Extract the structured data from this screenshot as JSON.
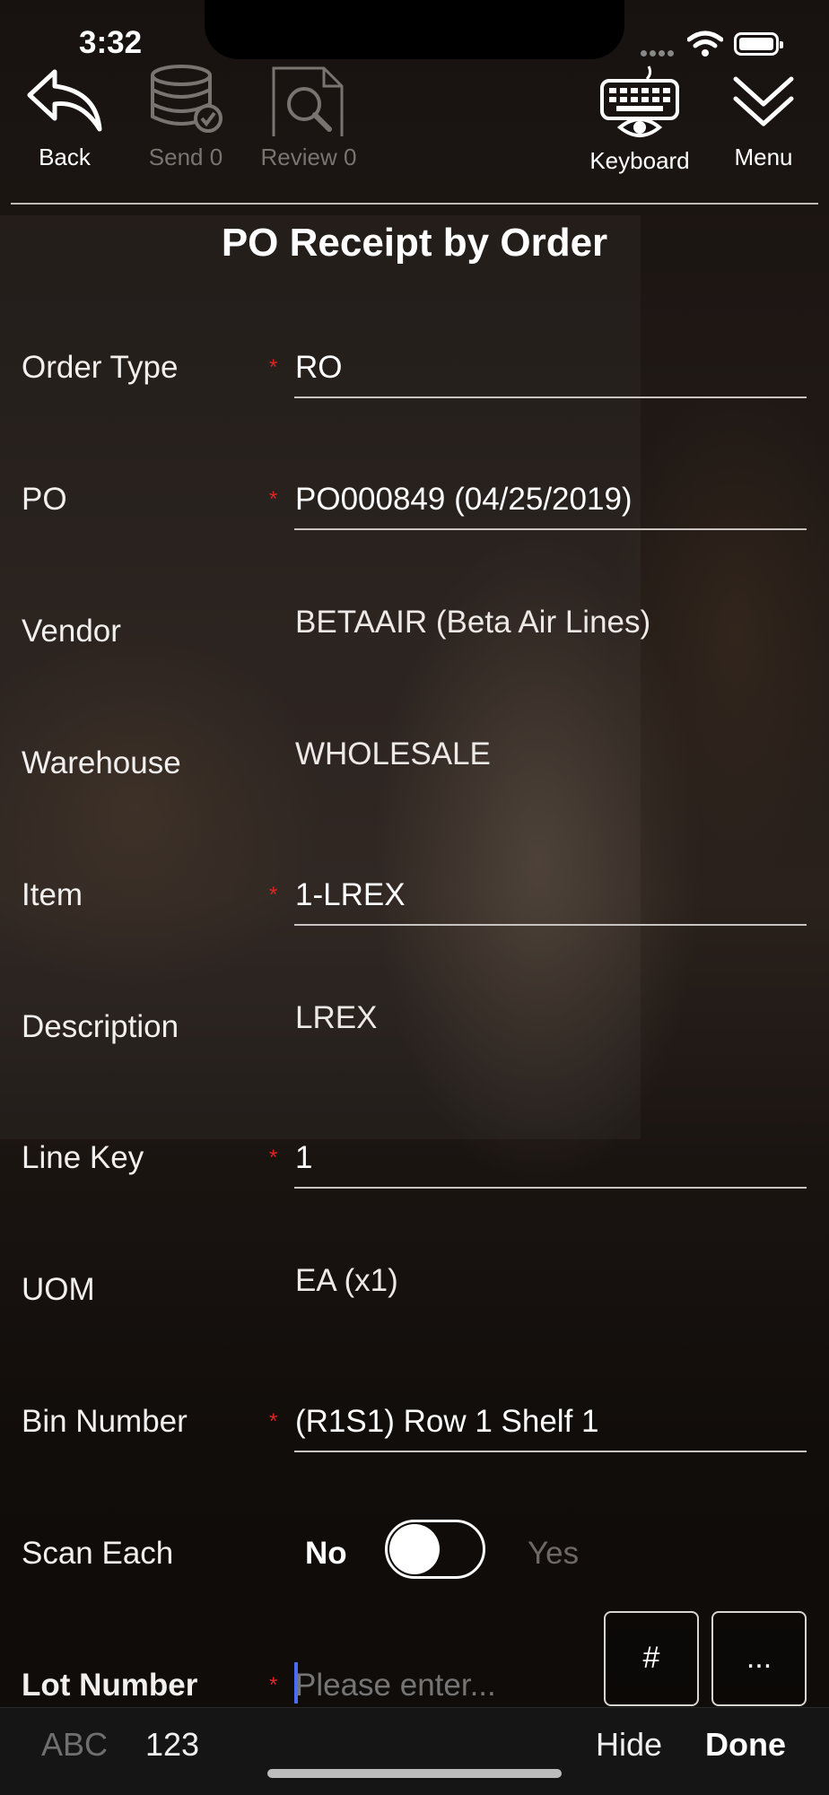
{
  "status": {
    "time": "3:32"
  },
  "toolbar": {
    "back": "Back",
    "send": "Send 0",
    "review": "Review 0",
    "keyboard": "Keyboard",
    "menu": "Menu"
  },
  "title": "PO Receipt by Order",
  "fields": {
    "order_type": {
      "label": "Order Type",
      "value": "RO"
    },
    "po": {
      "label": "PO",
      "value": "PO000849 (04/25/2019)"
    },
    "vendor": {
      "label": "Vendor",
      "value": "BETAAIR (Beta Air Lines)"
    },
    "warehouse": {
      "label": "Warehouse",
      "value": "WHOLESALE"
    },
    "item": {
      "label": "Item",
      "value": "1-LREX"
    },
    "description": {
      "label": "Description",
      "value": "LREX"
    },
    "line_key": {
      "label": "Line Key",
      "value": "1"
    },
    "uom": {
      "label": "UOM",
      "value": "EA (x1)"
    },
    "bin_number": {
      "label": "Bin Number",
      "value": "(R1S1) Row 1 Shelf 1"
    },
    "scan_each": {
      "label": "Scan Each",
      "off_label": "No",
      "on_label": "Yes"
    },
    "lot_number": {
      "label": "Lot Number",
      "placeholder": "Please enter..."
    }
  },
  "required_mark": "*",
  "quick_buttons": {
    "hash": "#",
    "more": "..."
  },
  "keyboard_bar": {
    "abc": "ABC",
    "num": "123",
    "hide": "Hide",
    "done": "Done"
  }
}
